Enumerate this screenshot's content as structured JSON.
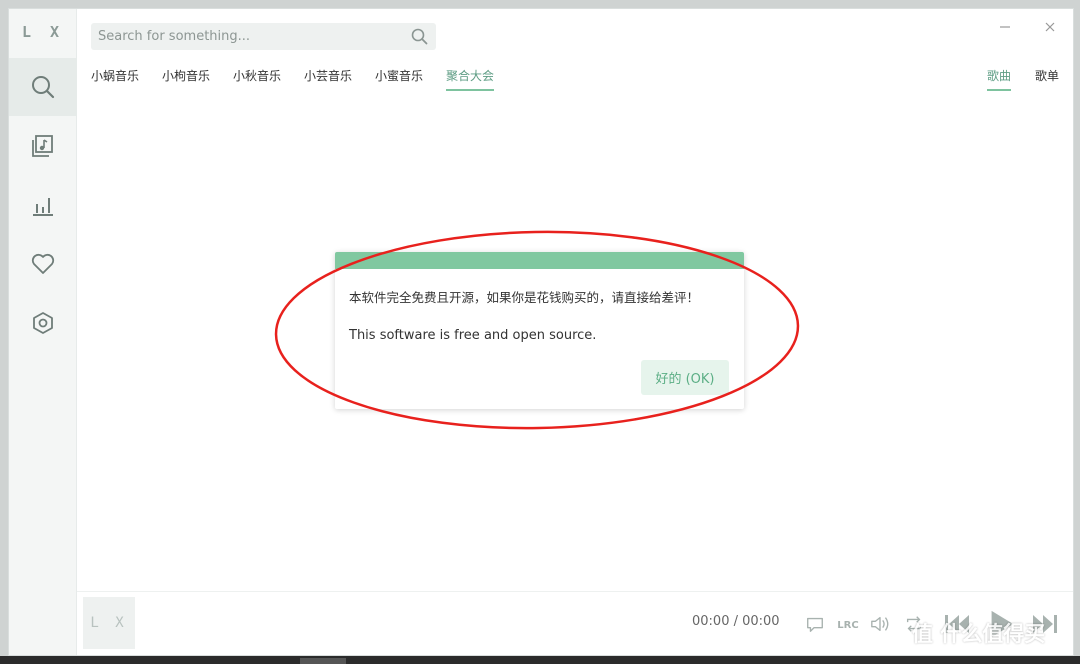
{
  "app": {
    "logo": "L X"
  },
  "search": {
    "placeholder": "Search for something..."
  },
  "sidebar": {
    "items": [
      {
        "icon": "search-icon",
        "active": true
      },
      {
        "icon": "music-playlist-icon",
        "active": false
      },
      {
        "icon": "leaderboard-icon",
        "active": false
      },
      {
        "icon": "heart-icon",
        "active": false
      },
      {
        "icon": "settings-icon",
        "active": false
      }
    ]
  },
  "window_controls": {
    "minimize": "—",
    "close": "✕"
  },
  "source_tabs": [
    {
      "label": "小蜗音乐",
      "active": false
    },
    {
      "label": "小枸音乐",
      "active": false
    },
    {
      "label": "小秋音乐",
      "active": false
    },
    {
      "label": "小芸音乐",
      "active": false
    },
    {
      "label": "小蜜音乐",
      "active": false
    },
    {
      "label": "聚合大会",
      "active": true
    }
  ],
  "type_tabs": [
    {
      "label": "歌曲",
      "active": true
    },
    {
      "label": "歌单",
      "active": false
    }
  ],
  "dialog": {
    "message_cn": "本软件完全免费且开源，如果你是花钱购买的，请直接给差评！",
    "message_en": "This software is free and open source.",
    "ok_label": "好的 (OK)"
  },
  "player": {
    "cover_text": "L X",
    "time": "00:00 / 00:00",
    "lyric_label": "LRC"
  },
  "watermark": "值 什么值得买",
  "colors": {
    "accent": "#80c8a0",
    "accent_text": "#5e9d84",
    "sidebar_bg": "#f4f6f5",
    "annotation": "#e8211d"
  }
}
